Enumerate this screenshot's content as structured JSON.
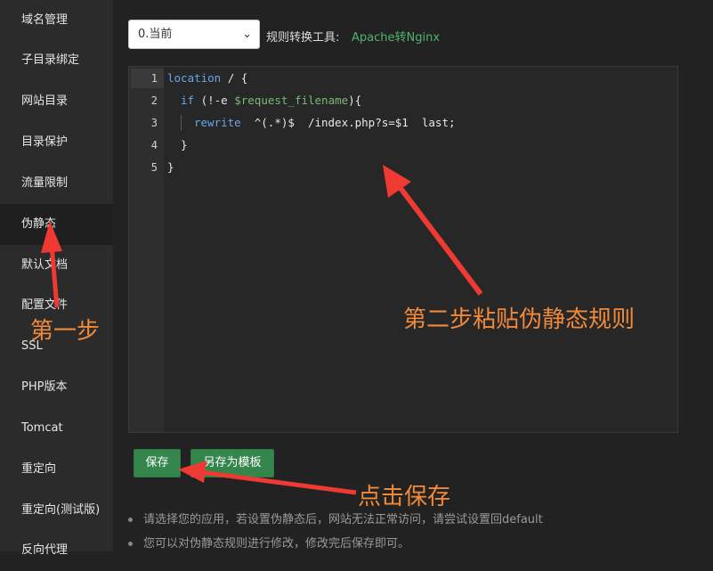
{
  "sidebar": {
    "items": [
      {
        "label": "域名管理"
      },
      {
        "label": "子目录绑定"
      },
      {
        "label": "网站目录"
      },
      {
        "label": "目录保护"
      },
      {
        "label": "流量限制"
      },
      {
        "label": "伪静态"
      },
      {
        "label": "默认文档"
      },
      {
        "label": "配置文件"
      },
      {
        "label": "SSL"
      },
      {
        "label": "PHP版本"
      },
      {
        "label": "Tomcat"
      },
      {
        "label": "重定向"
      },
      {
        "label": "重定向(测试版)"
      },
      {
        "label": "反向代理"
      }
    ],
    "active": "伪静态"
  },
  "toolbar": {
    "selected_rule": "0.当前",
    "tool_label": "规则转换工具:",
    "tool_link": "Apache转Nginx"
  },
  "editor": {
    "line_numbers": [
      "1",
      "2",
      "3",
      "4",
      "5"
    ],
    "lines": {
      "l1_kw": "location",
      "l1_rest": " / {",
      "l2_kw": "if",
      "l2_a": " (!-e ",
      "l2_var": "$request_filename",
      "l2_b": "){",
      "l3_kw": "rewrite",
      "l3_rest": "  ^(.*)$  /index.php?s=$1  last;",
      "l4": "}",
      "l5": "}"
    }
  },
  "buttons": {
    "save": "保存",
    "save_as_template": "另存为模板"
  },
  "notes": [
    "请选择您的应用，若设置伪静态后，网站无法正常访问，请尝试设置回default",
    "您可以对伪静态规则进行修改，修改完后保存即可。"
  ],
  "annotations": {
    "step1": "第一步",
    "step2": "第二步粘贴伪静态规则",
    "step3": "点击保存"
  },
  "colors": {
    "annotation": "#f08a3a",
    "arrow": "#ee3a33",
    "link": "#4fb56f",
    "button": "#34864c"
  }
}
